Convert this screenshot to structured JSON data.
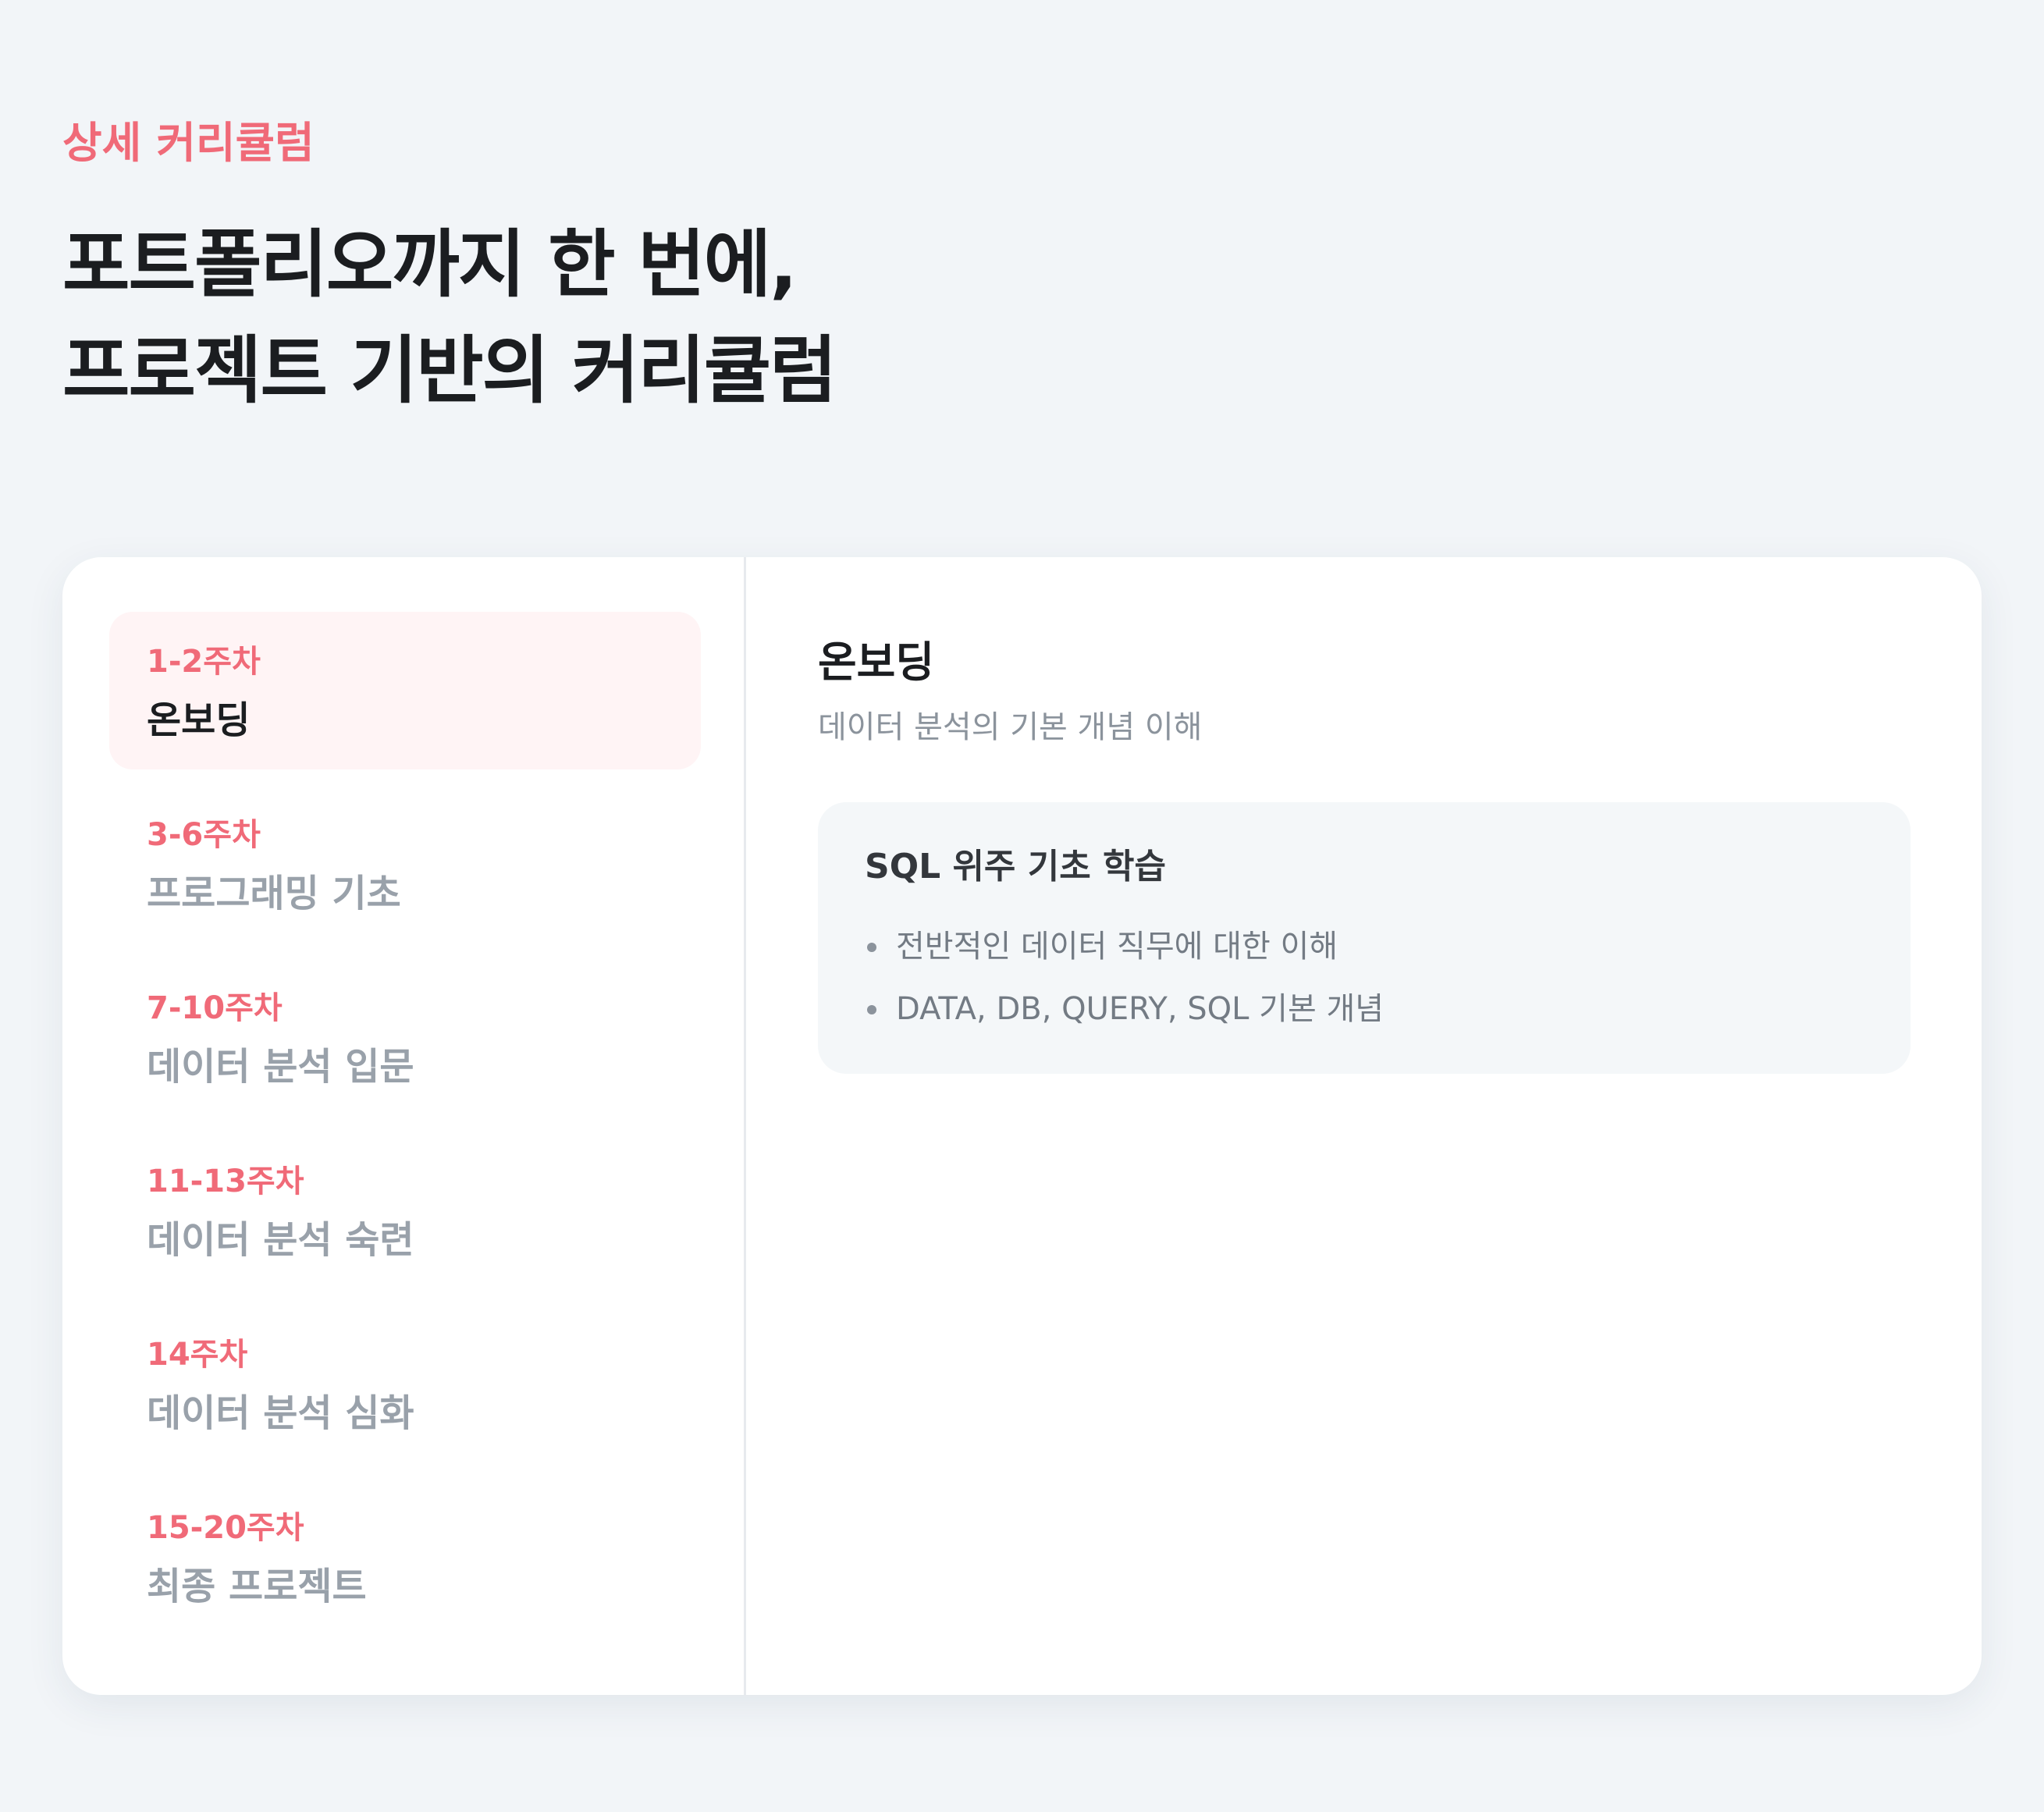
{
  "header": {
    "eyebrow": "상세 커리큘럼",
    "headline_line1": "포트폴리오까지 한 번에,",
    "headline_line2": "프로젝트 기반의 커리큘럼"
  },
  "nav": {
    "items": [
      {
        "week": "1-2주차",
        "title": "온보딩"
      },
      {
        "week": "3-6주차",
        "title": "프로그래밍 기초"
      },
      {
        "week": "7-10주차",
        "title": "데이터 분석 입문"
      },
      {
        "week": "11-13주차",
        "title": "데이터 분석 숙련"
      },
      {
        "week": "14주차",
        "title": "데이터 분석 심화"
      },
      {
        "week": "15-20주차",
        "title": "최종 프로젝트"
      }
    ],
    "active_index": 0
  },
  "detail": {
    "title": "온보딩",
    "subtitle": "데이터 분석의 기본 개념 이해",
    "topic": {
      "title": "SQL 위주 기초 학습",
      "bullets": [
        "전반적인 데이터 직무에 대한 이해",
        "DATA, DB, QUERY, SQL 기본 개념"
      ]
    }
  },
  "colors": {
    "accent": "#f06a78",
    "page_background": "#f2f5f8",
    "active_item_background": "#fff4f5",
    "inactive_text": "#99a1aa"
  }
}
